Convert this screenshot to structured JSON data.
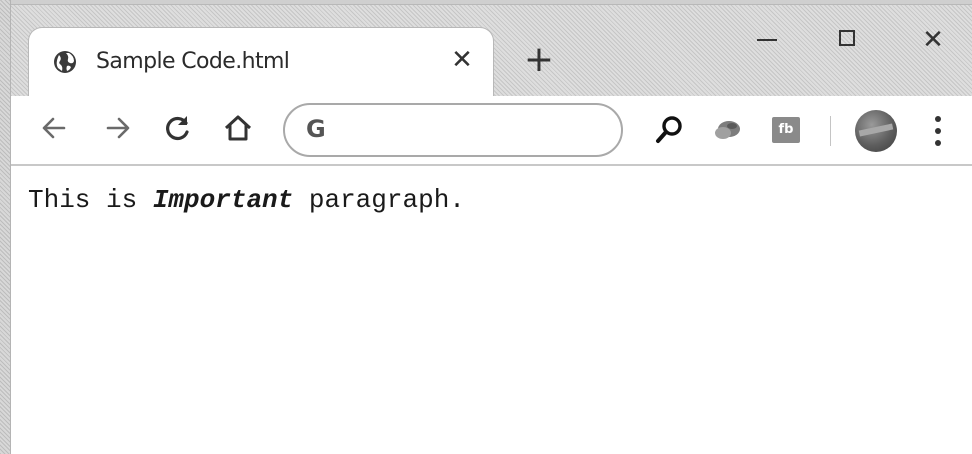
{
  "browser": {
    "tab": {
      "title": "Sample Code.html",
      "close_symbol": "✕",
      "favicon": "globe-icon"
    },
    "new_tab_symbol": "+",
    "window_controls": {
      "minimize": "minimize-icon",
      "maximize": "maximize-icon",
      "close_symbol": "✕"
    },
    "toolbar": {
      "back": "back-arrow-icon",
      "forward": "forward-arrow-icon",
      "reload": "reload-icon",
      "home": "home-icon",
      "omnibox_text": "G",
      "search": "search-icon",
      "extensions": [
        "extension-icon",
        "extension-badge-icon"
      ],
      "extension_badge_text": "fb",
      "profile": "avatar",
      "menu": "more-vert-icon"
    }
  },
  "page": {
    "paragraph": {
      "before": "This is ",
      "emphasis": "Important",
      "after": " paragraph."
    }
  },
  "colors": {
    "chrome_background": "#d4d4d4",
    "tab_background": "#ffffff",
    "text": "#1a1a1a"
  }
}
